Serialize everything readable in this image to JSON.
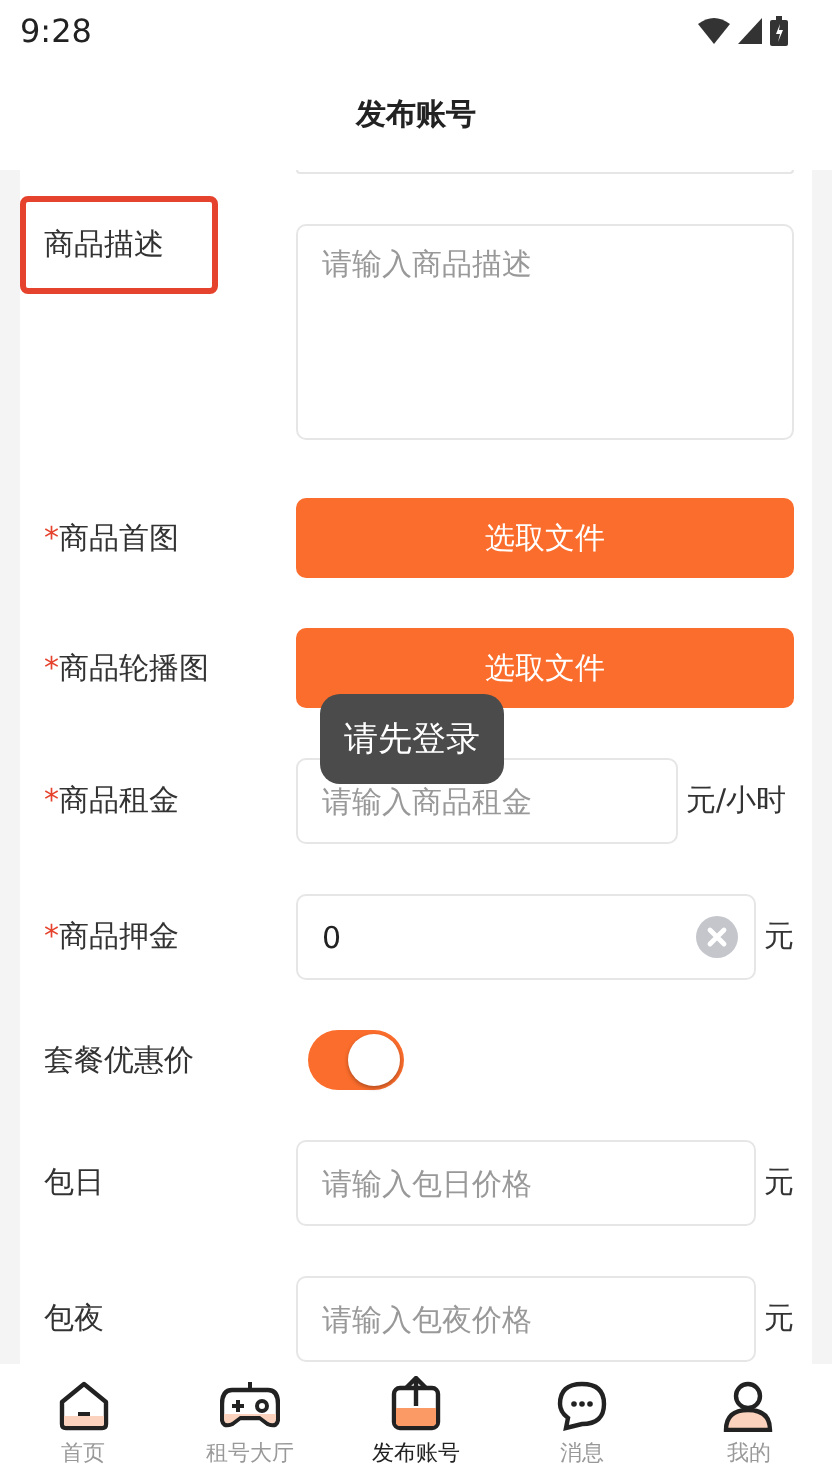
{
  "status_bar": {
    "time": "9:28"
  },
  "header": {
    "title": "发布账号"
  },
  "form": {
    "rows": [
      {
        "kind": "textarea",
        "label": "商品描述",
        "highlighted": true,
        "placeholder": "请输入商品描述"
      },
      {
        "kind": "file",
        "label": "商品首图",
        "required_mark": "*",
        "button": "选取文件"
      },
      {
        "kind": "file",
        "label": "商品轮播图",
        "required_mark": "*",
        "button": "选取文件"
      },
      {
        "kind": "input",
        "label": "商品租金",
        "required_mark": "*",
        "placeholder": "请输入商品租金",
        "unit": "元/小时"
      },
      {
        "kind": "input",
        "label": "商品押金",
        "required_mark": "*",
        "value": "0",
        "clearable": true,
        "unit": "元"
      },
      {
        "kind": "switch",
        "label": "套餐优惠价",
        "on": true
      },
      {
        "kind": "input",
        "label": "包日",
        "placeholder": "请输入包日价格",
        "unit": "元"
      },
      {
        "kind": "input",
        "label": "包夜",
        "placeholder": "请输入包夜价格",
        "unit": "元"
      }
    ]
  },
  "toast": {
    "text": "请先登录"
  },
  "tab_bar": {
    "items": [
      {
        "kind": "home",
        "label": "首页",
        "selected": false
      },
      {
        "kind": "gamepad",
        "label": "租号大厅",
        "selected": false
      },
      {
        "kind": "upload",
        "label": "发布账号",
        "selected": true
      },
      {
        "kind": "chat",
        "label": "消息",
        "selected": false
      },
      {
        "kind": "person",
        "label": "我的",
        "selected": false
      }
    ]
  }
}
